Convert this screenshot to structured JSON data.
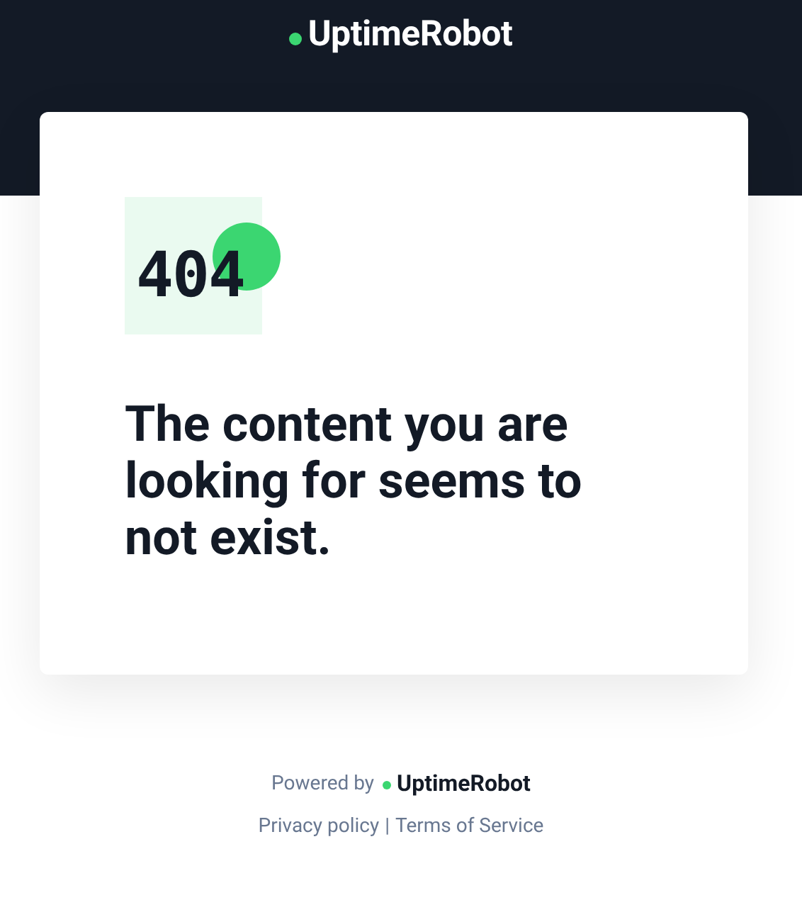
{
  "header": {
    "logo": "UptimeRobot"
  },
  "card": {
    "illustration": "404",
    "heading": "The content you are looking for seems to not exist."
  },
  "footer": {
    "powered_by": "Powered by",
    "logo": "UptimeRobot",
    "links": [
      {
        "label": "Privacy policy"
      },
      {
        "label": "Terms of Service"
      }
    ],
    "separator": "|"
  }
}
